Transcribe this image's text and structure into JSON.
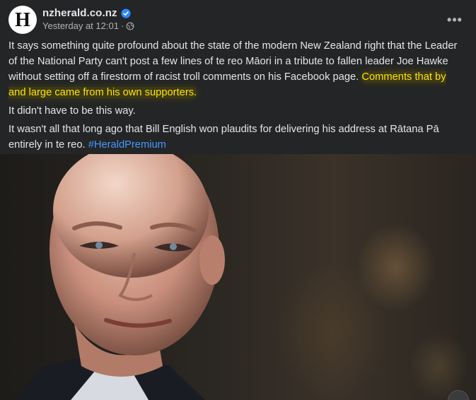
{
  "post": {
    "author": "nzherald.co.nz",
    "timestamp": "Yesterday at 12:01",
    "separator": "·",
    "more_label": "•••",
    "paragraph1_plain": "It says something quite profound about the state of the modern New Zealand right that the Leader of the National Party can't post a few lines of te reo Māori in a tribute to fallen leader Joe Hawke without setting off a firestorm of racist troll comments on his Facebook page.",
    "paragraph1_highlight": "Comments that by and large came from his own supporters.",
    "paragraph2": "It didn't have to be this way.",
    "paragraph3": "It wasn't all that long ago that Bill English won plaudits for delivering his address at Rātana Pā entirely in te reo.",
    "hashtag": "#HeraldPremium"
  },
  "logo": {
    "mark": "H"
  },
  "icons": {
    "verified": "verified-badge-icon",
    "audience": "globe-icon",
    "more": "more-options-icon"
  },
  "colors": {
    "background": "#242526",
    "highlight_text": "#ffe400",
    "hashtag": "#4599ff",
    "verified": "#2d88ff"
  }
}
